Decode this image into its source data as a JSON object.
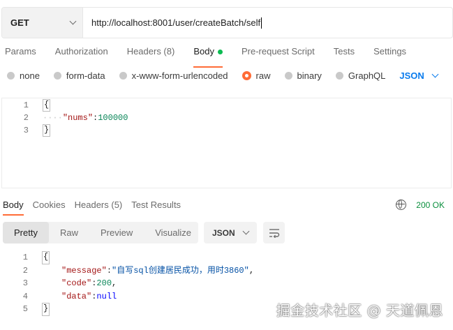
{
  "request": {
    "method": "GET",
    "url": "http://localhost:8001/user/createBatch/self"
  },
  "request_tabs": [
    {
      "label": "Params"
    },
    {
      "label": "Authorization"
    },
    {
      "label": "Headers (8)"
    },
    {
      "label": "Body",
      "active": true
    },
    {
      "label": "Pre-request Script"
    },
    {
      "label": "Tests"
    },
    {
      "label": "Settings"
    }
  ],
  "body_types": {
    "options": [
      "none",
      "form-data",
      "x-www-form-urlencoded",
      "raw",
      "binary",
      "GraphQL"
    ],
    "selected": "raw",
    "language": "JSON"
  },
  "request_body": {
    "line_numbers": [
      "1",
      "2",
      "3"
    ],
    "open_brace": "{",
    "key": "\"nums\"",
    "colon": ":",
    "value": "100000",
    "close_brace": "}"
  },
  "response_tabs": [
    {
      "label": "Body",
      "active": true
    },
    {
      "label": "Cookies"
    },
    {
      "label": "Headers (5)"
    },
    {
      "label": "Test Results"
    }
  ],
  "status": {
    "text": "200 OK",
    "color": "#0a8f3d",
    "icon": "globe-icon"
  },
  "view_modes": {
    "buttons": [
      "Pretty",
      "Raw",
      "Preview",
      "Visualize"
    ],
    "active": "Pretty",
    "format": "JSON",
    "wrap_icon": "wrap-lines-icon"
  },
  "response_body": {
    "line_numbers": [
      "1",
      "2",
      "3",
      "4",
      "5"
    ],
    "open_brace": "{",
    "lines": [
      {
        "key": "\"message\"",
        "value": "\"自写sql创建居民成功，用时3860\"",
        "trail": ","
      },
      {
        "key": "\"code\"",
        "value": "200",
        "trail": ","
      },
      {
        "key": "\"data\"",
        "value": "null",
        "trail": ""
      }
    ],
    "close_brace": "}"
  },
  "watermark": "掘金技术社区 @ 天道佩恩",
  "colors": {
    "accent": "#ff6c37",
    "link": "#097bed",
    "ok": "#0cbb52"
  }
}
